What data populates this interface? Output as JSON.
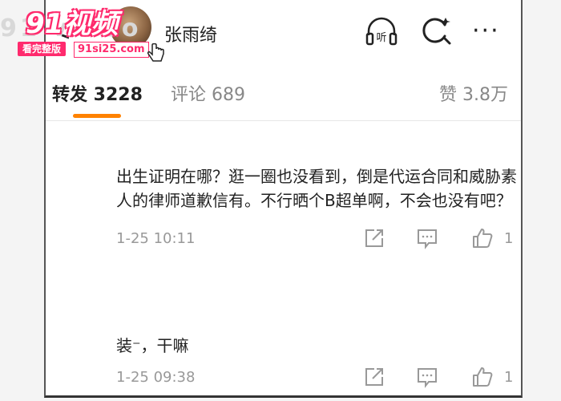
{
  "watermark": {
    "title": "91视频",
    "background_text": "91 video",
    "button_label": "看完整版",
    "url": "91si25.com"
  },
  "header": {
    "back_glyph": "<",
    "user_name": "张雨绮",
    "listen_label": "听",
    "more_glyph": "···"
  },
  "tabs": {
    "repost": "转发 3228",
    "comments": "评论 689",
    "likes": "赞 3.8万",
    "accent_color": "#ff8200"
  },
  "comments": [
    {
      "text": "出生证明在哪？逛一圈也没看到，倒是代运合同和威胁素人的律师道歉信有。不行晒个B超单啊，不会也没有吧？",
      "timestamp": "1-25 10:11",
      "likes": "1"
    },
    {
      "text": "装⁻，干嘛",
      "timestamp": "1-25 09:38",
      "likes": "1"
    }
  ]
}
